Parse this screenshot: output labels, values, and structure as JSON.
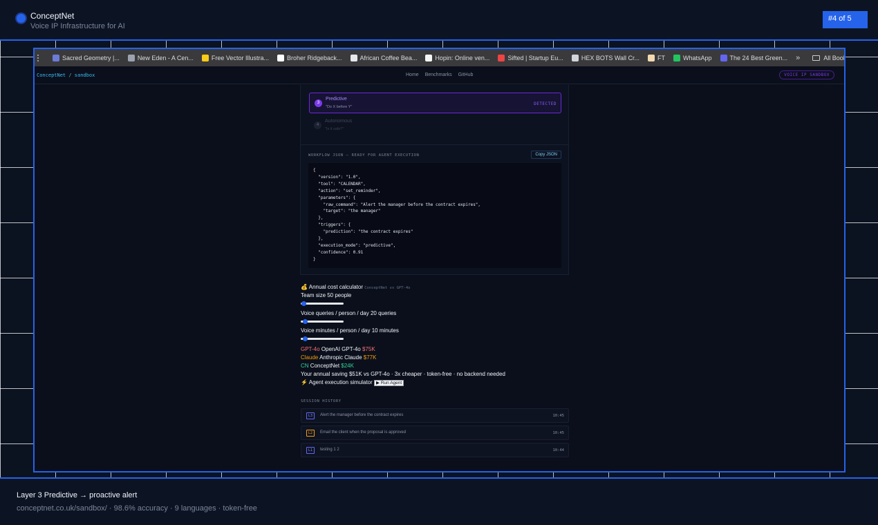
{
  "header": {
    "brand": "ConceptNet",
    "tagline": "Voice IP Infrastructure for AI",
    "counter": "#4 of 5"
  },
  "bookmarks": {
    "items": [
      {
        "label": "Sacred Geometry |...",
        "icon": "wordpress-icon",
        "color": "#6b7bd6"
      },
      {
        "label": "New Eden - A Cen...",
        "icon": "gear-icon",
        "color": "#9ca3af"
      },
      {
        "label": "Free Vector Illustra...",
        "icon": "letter-icon",
        "color": "#facc15"
      },
      {
        "label": "Broher Ridgeback...",
        "icon": "patreon-icon",
        "color": "#ffffff"
      },
      {
        "label": "African Coffee Bea...",
        "icon": "coffee-icon",
        "color": "#e5e7eb"
      },
      {
        "label": "Hopin: Online ven...",
        "icon": "h-icon",
        "color": "#f5f5f5"
      },
      {
        "label": "Sifted | Startup Eu...",
        "icon": "sifted-icon",
        "color": "#ef4444"
      },
      {
        "label": "HEX BOTS Wall Cr...",
        "icon": "globe-icon",
        "color": "#d1d5db"
      },
      {
        "label": "FT",
        "icon": "ft-icon",
        "color": "#f3d9b1"
      },
      {
        "label": "WhatsApp",
        "icon": "whatsapp-icon",
        "color": "#22c55e"
      },
      {
        "label": "The 24 Best Green...",
        "icon": "link-icon",
        "color": "#6366f1"
      }
    ],
    "more": "»",
    "all_label": "All Bookmarks"
  },
  "app": {
    "breadcrumb": "ConceptNet / sandbox",
    "nav": [
      "Home",
      "Benchmarks",
      "GitHub"
    ],
    "badge": "VOICE IP SANDBOX"
  },
  "layers": {
    "active": {
      "num": "3",
      "title": "Predictive",
      "subtitle": "\"Do X before Y\"",
      "status": "DETECTED"
    },
    "next": {
      "num": "4",
      "title": "Autonomous",
      "subtitle": "\"Is it safe?\""
    }
  },
  "workflow": {
    "label": "WORKFLOW JSON — READY FOR AGENT EXECUTION",
    "copy_label": "Copy JSON",
    "json": "{\n  \"version\": \"1.0\",\n  \"tool\": \"CALENDAR\",\n  \"action\": \"set_reminder\",\n  \"parameters\": {\n    \"raw_command\": \"Alert the manager before the contract expires\",\n    \"target\": \"the manager\"\n  },\n  \"triggers\": {\n    \"prediction\": \"the contract expires\"\n  },\n  \"execution_mode\": \"predictive\",\n  \"confidence\": 0.91\n}"
  },
  "calculator": {
    "title": "💰 Annual cost calculator",
    "subtitle": "ConceptNet vs GPT-4o",
    "team_label": "Team size 50 people",
    "team_level": 0.02,
    "queries_label": "Voice queries / person / day 20 queries",
    "queries_level": 0.05,
    "minutes_label": "Voice minutes / person / day 10 minutes",
    "minutes_level": 0.05,
    "gpt": {
      "tag": "GPT-4o",
      "name": "OpenAI GPT-4o",
      "cost": "$75K"
    },
    "claude": {
      "tag": "Claude",
      "name": "Anthropic Claude",
      "cost": "$77K"
    },
    "cn": {
      "tag": "CN",
      "name": "ConceptNet",
      "cost": "$24K"
    },
    "saving": "Your annual saving $51K vs GPT-4o · 3x cheaper · token-free · no backend needed",
    "agent_label": "⚡ Agent execution simulator",
    "run_label": "▶ Run Agent"
  },
  "history": {
    "label": "SESSION HISTORY",
    "items": [
      {
        "level": "L3",
        "text": "Alert the manager before the contract expires",
        "time": "10:45"
      },
      {
        "level": "L2",
        "text": "Email the client when the proposal is approved",
        "time": "10:45"
      },
      {
        "level": "L1",
        "text": "testing 1 2",
        "time": "10:44"
      }
    ]
  },
  "caption": {
    "title": "Layer 3 Predictive → proactive alert",
    "subtitle": "conceptnet.co.uk/sandbox/ · 98.6% accuracy · 9 languages · token-free"
  }
}
